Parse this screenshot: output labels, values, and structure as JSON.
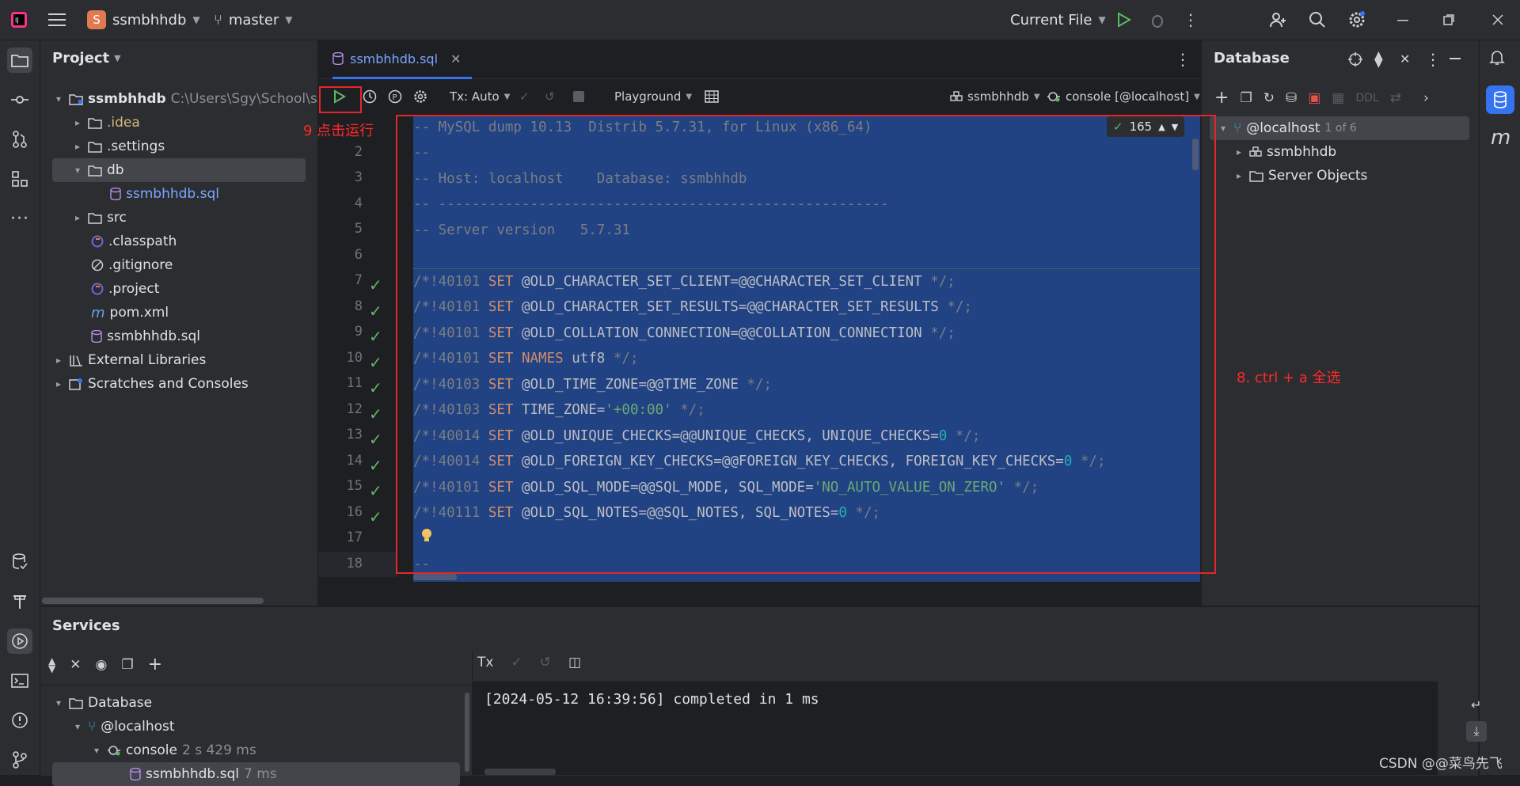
{
  "titlebar": {
    "project_initial": "S",
    "project_name": "ssmbhhdb",
    "branch": "master",
    "run_config": "Current File"
  },
  "project_panel": {
    "title": "Project",
    "tree": [
      {
        "label": "ssmbhhdb",
        "path": "C:\\Users\\Sgy\\School\\ss"
      },
      {
        "label": ".idea"
      },
      {
        "label": ".settings"
      },
      {
        "label": "db"
      },
      {
        "label": "ssmbhhdb.sql"
      },
      {
        "label": "src"
      },
      {
        "label": ".classpath"
      },
      {
        "label": ".gitignore"
      },
      {
        "label": ".project"
      },
      {
        "label": "pom.xml"
      },
      {
        "label": "ssmbhhdb.sql"
      },
      {
        "label": "External Libraries"
      },
      {
        "label": "Scratches and Consoles"
      }
    ]
  },
  "editor": {
    "tab_label": "ssmbhhdb.sql",
    "tx_mode": "Tx: Auto",
    "playground": "Playground",
    "schema": "ssmbhhdb",
    "session": "console [@localhost]",
    "inspection_count": "165",
    "line_numbers": [
      "2",
      "3",
      "4",
      "5",
      "6",
      "7",
      "8",
      "9",
      "10",
      "11",
      "12",
      "13",
      "14",
      "15",
      "16",
      "17",
      "18"
    ]
  },
  "code_lines": {
    "l1": "-- MySQL dump 10.13  Distrib 5.7.31, for Linux (x86_64)",
    "l2": "--",
    "l3": "-- Host: localhost    Database: ssmbhhdb",
    "l4": "-- ------------------------------------------------------",
    "l5": "-- Server version   5.7.31",
    "l7a": "/*!40101 ",
    "l7b": "SET",
    "l7c": " @OLD_CHARACTER_SET_CLIENT=@@CHARACTER_SET_CLIENT ",
    "l7d": "*/;",
    "l8a": "/*!40101 ",
    "l8b": "SET",
    "l8c": " @OLD_CHARACTER_SET_RESULTS=@@CHARACTER_SET_RESULTS ",
    "l8d": "*/;",
    "l9a": "/*!40101 ",
    "l9b": "SET",
    "l9c": " @OLD_COLLATION_CONNECTION=@@COLLATION_CONNECTION ",
    "l9d": "*/;",
    "l10a": "/*!40101 ",
    "l10b": "SET NAMES",
    "l10c": " utf8 ",
    "l10d": "*/;",
    "l11a": "/*!40103 ",
    "l11b": "SET",
    "l11c": " @OLD_TIME_ZONE=@@TIME_ZONE ",
    "l11d": "*/;",
    "l12a": "/*!40103 ",
    "l12b": "SET",
    "l12c": " TIME_ZONE=",
    "l12s": "'+00:00'",
    "l12d": " */;",
    "l13a": "/*!40014 ",
    "l13b": "SET",
    "l13c": " @OLD_UNIQUE_CHECKS=@@UNIQUE_CHECKS, UNIQUE_CHECKS=",
    "l13n": "0",
    "l13d": " */;",
    "l14a": "/*!40014 ",
    "l14b": "SET",
    "l14c": " @OLD_FOREIGN_KEY_CHECKS=@@FOREIGN_KEY_CHECKS, FOREIGN_KEY_CHECKS=",
    "l14n": "0",
    "l14d": " */;",
    "l15a": "/*!40101 ",
    "l15b": "SET",
    "l15c": " @OLD_SQL_MODE=@@SQL_MODE, SQL_MODE=",
    "l15s": "'NO_AUTO_VALUE_ON_ZERO'",
    "l15d": " */;",
    "l16a": "/*!40111 ",
    "l16b": "SET",
    "l16c": " @OLD_SQL_NOTES=@@SQL_NOTES, SQL_NOTES=",
    "l16n": "0",
    "l16d": " */;",
    "l18": "--"
  },
  "db_panel": {
    "title": "Database",
    "ddl": "DDL",
    "host": "@localhost",
    "host_count": "1 of 6",
    "items": [
      "ssmbhhdb",
      "Server Objects"
    ]
  },
  "services": {
    "title": "Services",
    "tx": "Tx",
    "tree": [
      {
        "label": "Database"
      },
      {
        "label": "@localhost"
      },
      {
        "label": "console",
        "meta": "2 s 429 ms"
      },
      {
        "label": "ssmbhhdb.sql",
        "meta": "7 ms"
      }
    ],
    "output": "[2024-05-12 16:39:56] completed in 1 ms"
  },
  "annotations": {
    "run": "9 点击运行",
    "select_all": "8. ctrl + a 全选",
    "watermark": "CSDN @@菜鸟先飞"
  },
  "colors": {
    "selection": "#214283",
    "accent": "#3574f0",
    "annotation_red": "#e5252a",
    "run_green": "#5fb865"
  }
}
